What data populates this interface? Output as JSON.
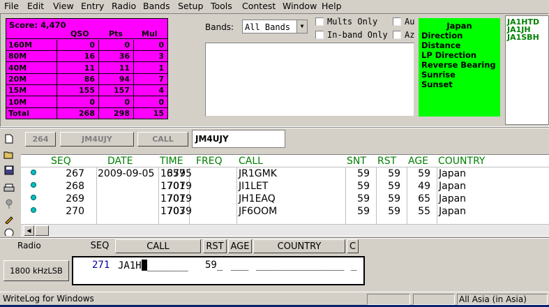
{
  "menu": [
    "File",
    "Edit",
    "View",
    "Entry",
    "Radio",
    "Bands",
    "Setup",
    "Tools",
    "Contest",
    "Window",
    "Help"
  ],
  "score": {
    "title": "Score: 4,470",
    "headers": [
      "QSO",
      "Pts",
      "Mul"
    ],
    "rows": [
      {
        "band": "160M",
        "qso": "0",
        "pts": "0",
        "mul": "0"
      },
      {
        "band": "80M",
        "qso": "16",
        "pts": "36",
        "mul": "3"
      },
      {
        "band": "40M",
        "qso": "11",
        "pts": "11",
        "mul": "1"
      },
      {
        "band": "20M",
        "qso": "86",
        "pts": "94",
        "mul": "7"
      },
      {
        "band": "15M",
        "qso": "155",
        "pts": "157",
        "mul": "4"
      },
      {
        "band": "10M",
        "qso": "0",
        "pts": "0",
        "mul": "0"
      },
      {
        "band": "Total",
        "qso": "268",
        "pts": "298",
        "mul": "15"
      }
    ]
  },
  "bands": {
    "label": "Bands:",
    "selected": "All Bands",
    "mults_only": "Mults Only",
    "inband_only": "In-band Only",
    "au": "Au",
    "az": "Az"
  },
  "info": {
    "country": "Japan",
    "lines": [
      "Direction",
      "Distance",
      "LP Direction",
      "Reverse Bearing",
      "Sunrise",
      "Sunset"
    ]
  },
  "callsigns": [
    "JA1HTD",
    "JA1JH",
    "JA1SBH"
  ],
  "strip": {
    "seq": "264",
    "call1": "JM4UJY",
    "call_label": "CALL",
    "entry": "JM4UJY"
  },
  "log": {
    "headers": [
      "SEQ",
      "DATE",
      "TIME",
      "FREQ",
      "CALL",
      "SNT",
      "RST",
      "AGE",
      "COUNTRY"
    ],
    "rows": [
      {
        "seq": "267",
        "date": "2009-09-05",
        "time": "1657",
        "freq": "3795",
        "call": "JR1GMK",
        "snt": "59",
        "rst": "59",
        "age": "59",
        "country": "Japan"
      },
      {
        "seq": "268",
        "date": "",
        "time": "1701",
        "freq": "7079",
        "call": "JI1LET",
        "snt": "59",
        "rst": "59",
        "age": "49",
        "country": "Japan"
      },
      {
        "seq": "269",
        "date": "",
        "time": "1701",
        "freq": "7079",
        "call": "JH1EAQ",
        "snt": "59",
        "rst": "59",
        "age": "65",
        "country": "Japan"
      },
      {
        "seq": "270",
        "date": "",
        "time": "1703",
        "freq": "7079",
        "call": "JF6OOM",
        "snt": "59",
        "rst": "59",
        "age": "55",
        "country": "Japan"
      }
    ]
  },
  "entry": {
    "radio_label": "Radio",
    "radio_button": "1800 kHzLSB",
    "headers": {
      "seq": "SEQ",
      "call": "CALL",
      "rst": "RST",
      "age": "AGE",
      "country": "COUNTRY",
      "c": "C"
    },
    "seq": "271",
    "call": "JA1H",
    "call_fill": "_______",
    "rst": "59_",
    "age": "___",
    "country": "_______________",
    "c": "_"
  },
  "status": {
    "left": "WriteLog for Windows",
    "right": "All Asia (in Asia)"
  }
}
